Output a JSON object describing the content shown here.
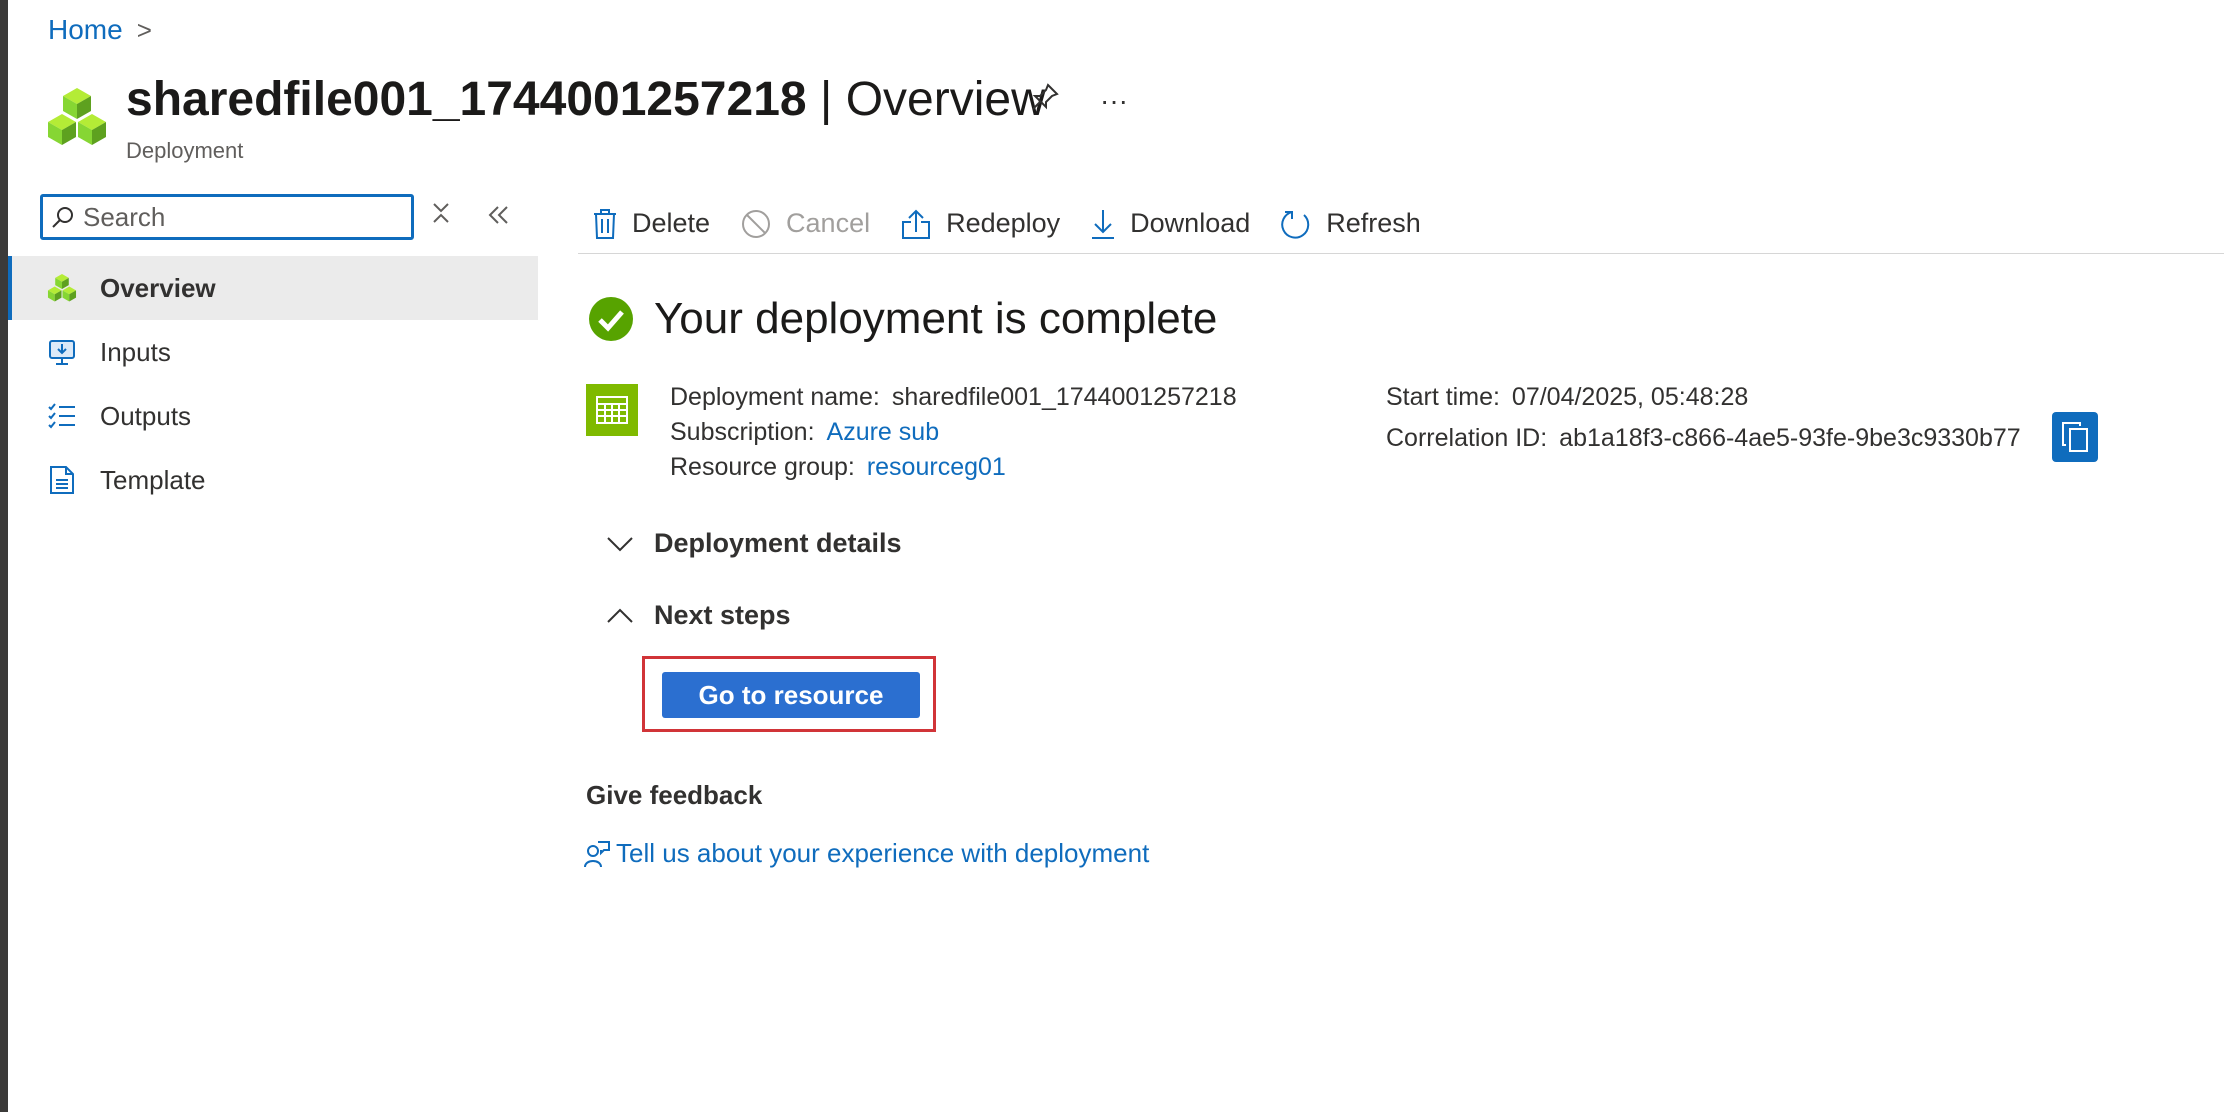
{
  "breadcrumb": {
    "home": "Home",
    "separator": ">"
  },
  "header": {
    "title_bold": "sharedfile001_1744001257218",
    "title_rest": " | Overview",
    "subtitle": "Deployment",
    "pin_icon": "pin-icon",
    "more_label": "···"
  },
  "search": {
    "placeholder": "Search",
    "value": ""
  },
  "sidebar": {
    "items": [
      {
        "label": "Overview",
        "icon": "cubes-icon",
        "active": true
      },
      {
        "label": "Inputs",
        "icon": "inputs-icon",
        "active": false
      },
      {
        "label": "Outputs",
        "icon": "outputs-icon",
        "active": false
      },
      {
        "label": "Template",
        "icon": "template-icon",
        "active": false
      }
    ]
  },
  "toolbar": {
    "delete": "Delete",
    "cancel": "Cancel",
    "redeploy": "Redeploy",
    "download": "Download",
    "refresh": "Refresh"
  },
  "status": {
    "message": "Your deployment is complete",
    "color": "#57a300"
  },
  "info": {
    "deployment_name_label": "Deployment name:",
    "deployment_name": "sharedfile001_1744001257218",
    "subscription_label": "Subscription:",
    "subscription": "Azure sub",
    "resource_group_label": "Resource group:",
    "resource_group": "resourceg01",
    "start_time_label": "Start time:",
    "start_time": "07/04/2025, 05:48:28",
    "correlation_label": "Correlation ID:",
    "correlation_id": "ab1a18f3-c866-4ae5-93fe-9be3c9330b77"
  },
  "sections": {
    "deployment_details": "Deployment details",
    "next_steps": "Next steps"
  },
  "next_steps": {
    "go_to_resource": "Go to resource"
  },
  "feedback": {
    "title": "Give feedback",
    "link": "Tell us about your experience with deployment"
  },
  "colors": {
    "accent": "#0f6cbd",
    "highlight": "#d13438",
    "primary_button": "#2b6fd0"
  }
}
